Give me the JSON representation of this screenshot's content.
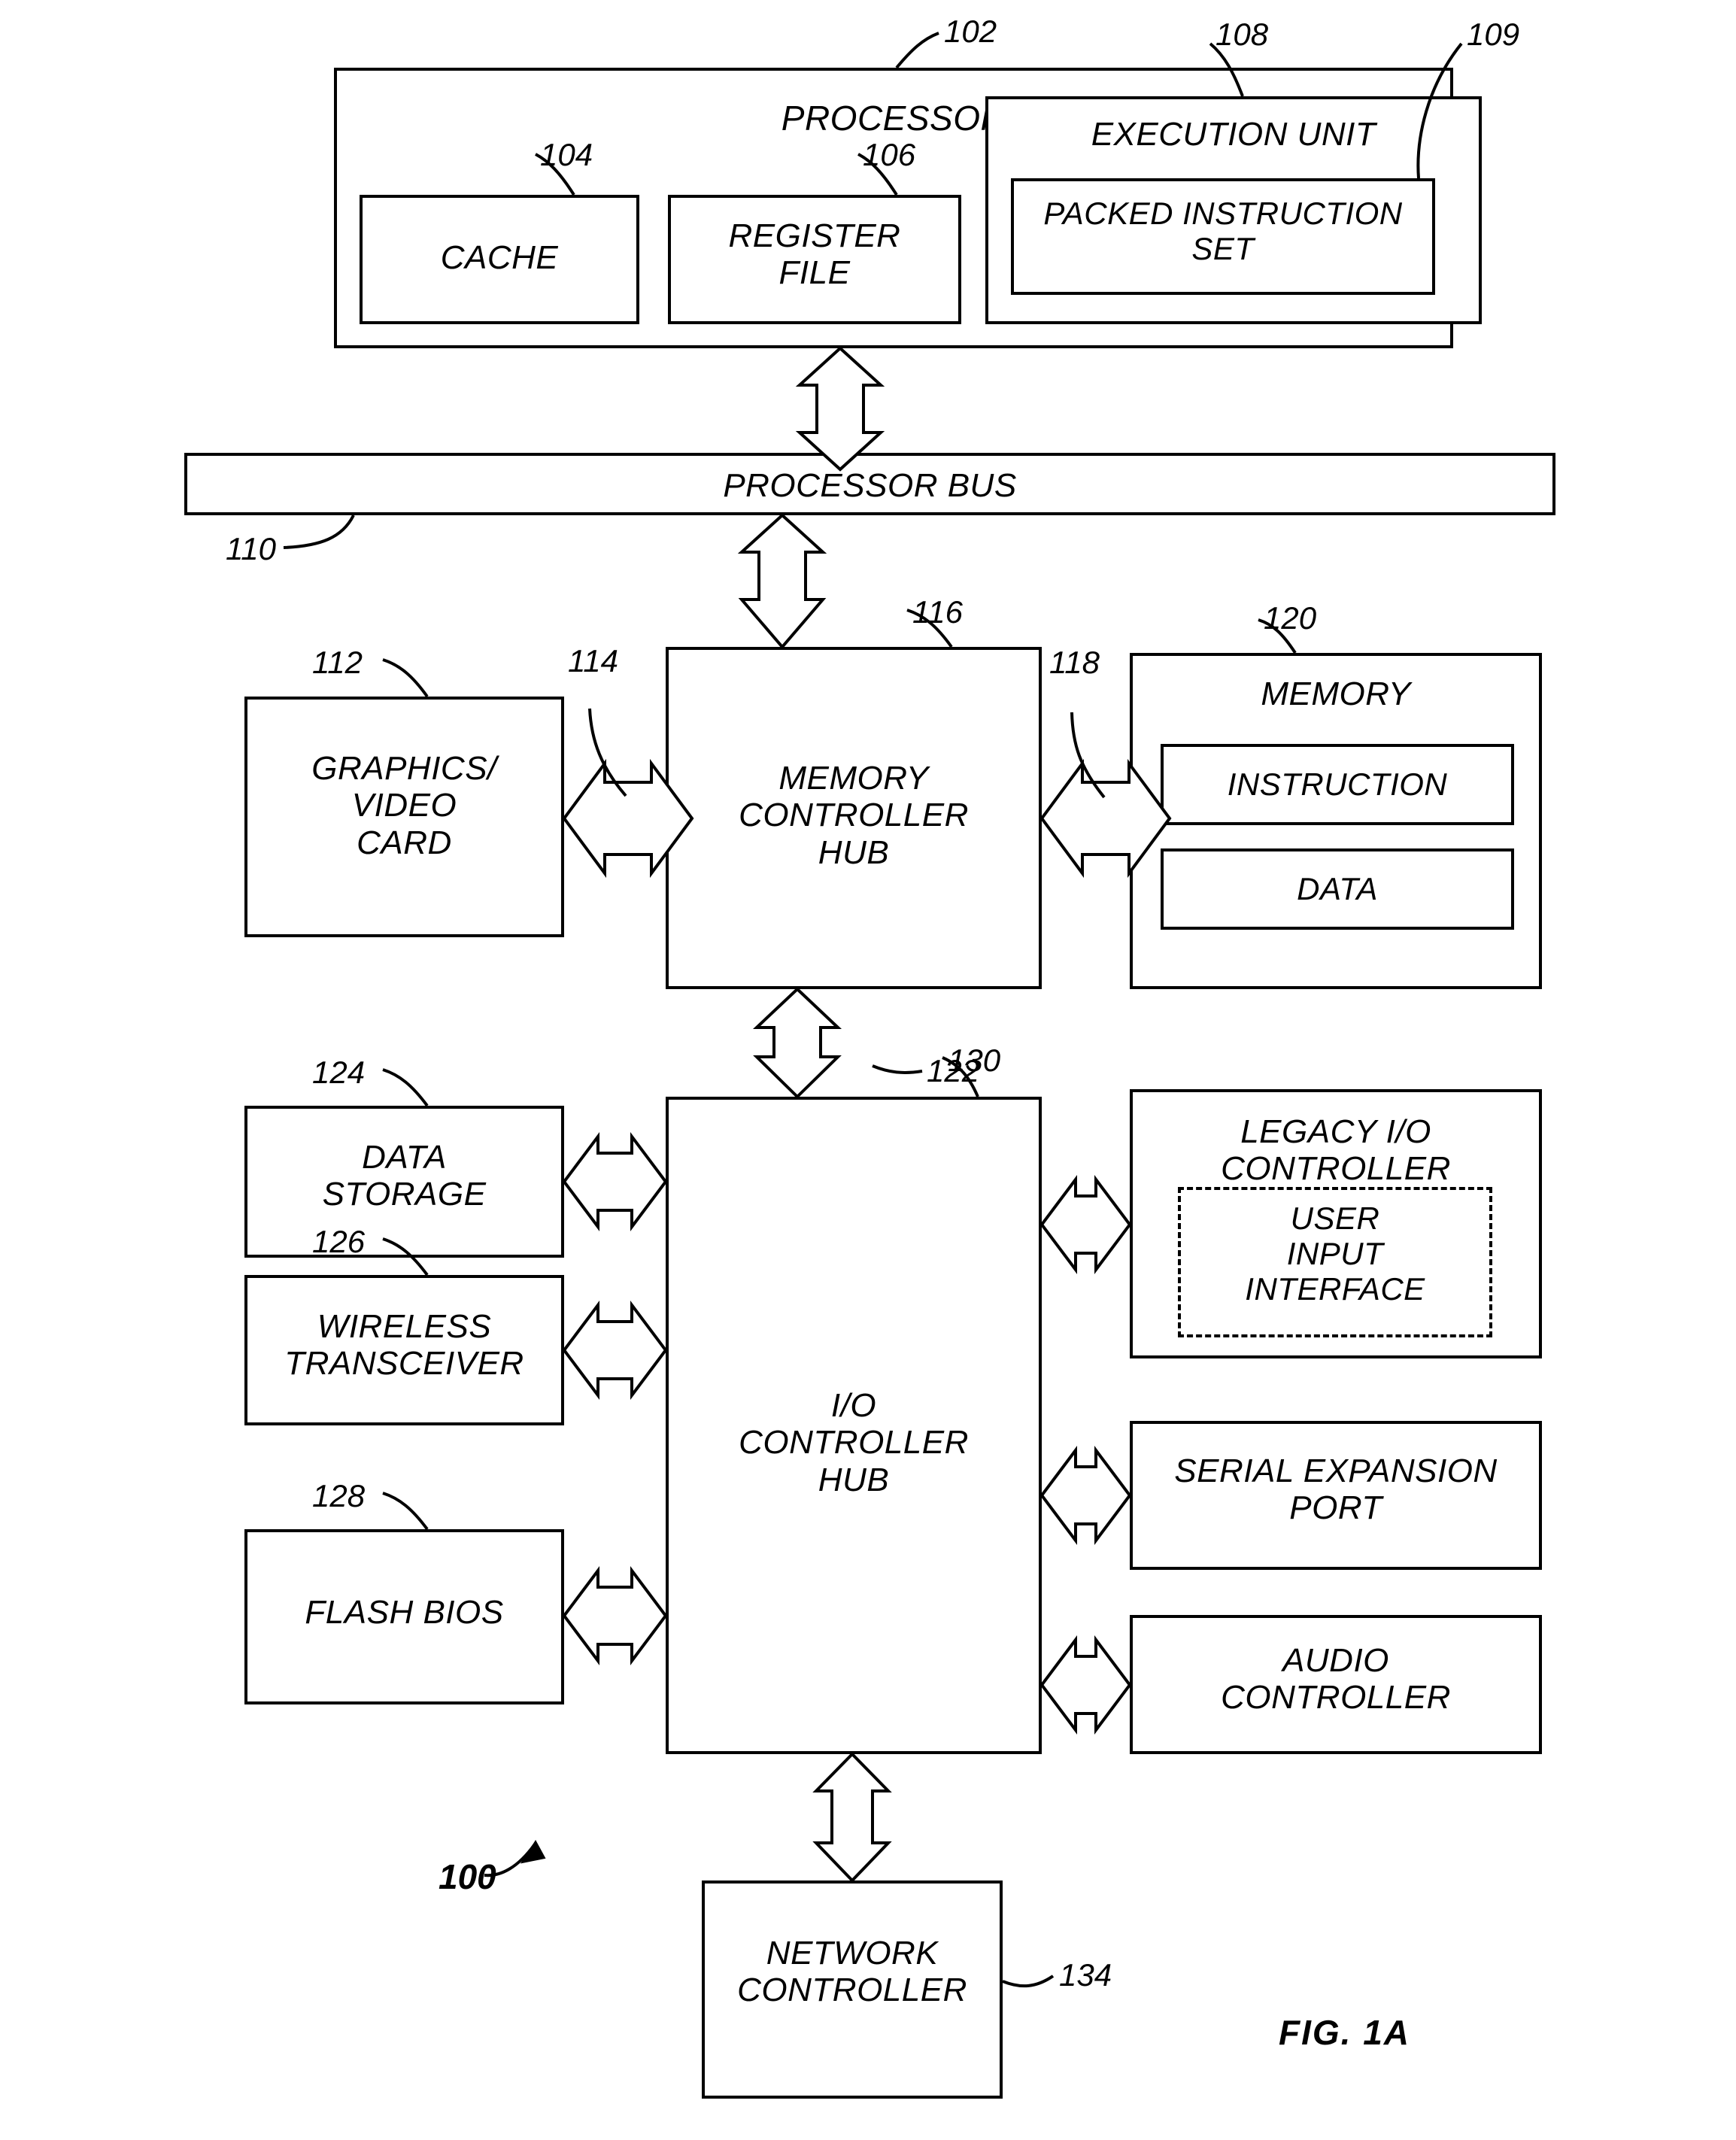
{
  "figure": {
    "caption": "FIG. 1A",
    "system_ref": "100"
  },
  "blocks": {
    "processor": {
      "label": "PROCESSOR",
      "ref": "102"
    },
    "cache": {
      "label": "CACHE",
      "ref": "104"
    },
    "register_file": {
      "label": "REGISTER\nFILE",
      "ref": "106"
    },
    "execution_unit": {
      "label": "EXECUTION UNIT",
      "ref": "108"
    },
    "packed_instruction_set": {
      "label": "PACKED INSTRUCTION\nSET",
      "ref": "109"
    },
    "processor_bus": {
      "label": "PROCESSOR BUS",
      "ref": "110"
    },
    "graphics_video_card": {
      "label": "GRAPHICS/\nVIDEO\nCARD",
      "ref": "112"
    },
    "mch_graphics_link": {
      "label": "",
      "ref": "114"
    },
    "memory_controller_hub": {
      "label": "MEMORY\nCONTROLLER\nHUB",
      "ref": "116"
    },
    "mch_memory_link": {
      "label": "",
      "ref": "118"
    },
    "memory": {
      "label": "MEMORY",
      "ref": "120"
    },
    "instruction": {
      "label": "INSTRUCTION",
      "ref": ""
    },
    "data": {
      "label": "DATA",
      "ref": ""
    },
    "hub_interface": {
      "label": "",
      "ref": "122"
    },
    "data_storage": {
      "label": "DATA\nSTORAGE",
      "ref": "124"
    },
    "wireless_transceiver": {
      "label": "WIRELESS\nTRANSCEIVER",
      "ref": "126"
    },
    "flash_bios": {
      "label": "FLASH BIOS",
      "ref": "128"
    },
    "io_controller_hub": {
      "label": "I/O\nCONTROLLER\nHUB",
      "ref": "130"
    },
    "legacy_io_controller": {
      "label": "LEGACY I/O\nCONTROLLER",
      "ref": ""
    },
    "user_input_interface": {
      "label": "USER\nINPUT\nINTERFACE",
      "ref": ""
    },
    "serial_expansion_port": {
      "label": "SERIAL EXPANSION\nPORT",
      "ref": ""
    },
    "audio_controller": {
      "label": "AUDIO\nCONTROLLER",
      "ref": ""
    },
    "network_controller": {
      "label": "NETWORK\nCONTROLLER",
      "ref": "134"
    }
  },
  "style": {
    "ink": "#000000",
    "paper": "#ffffff"
  }
}
